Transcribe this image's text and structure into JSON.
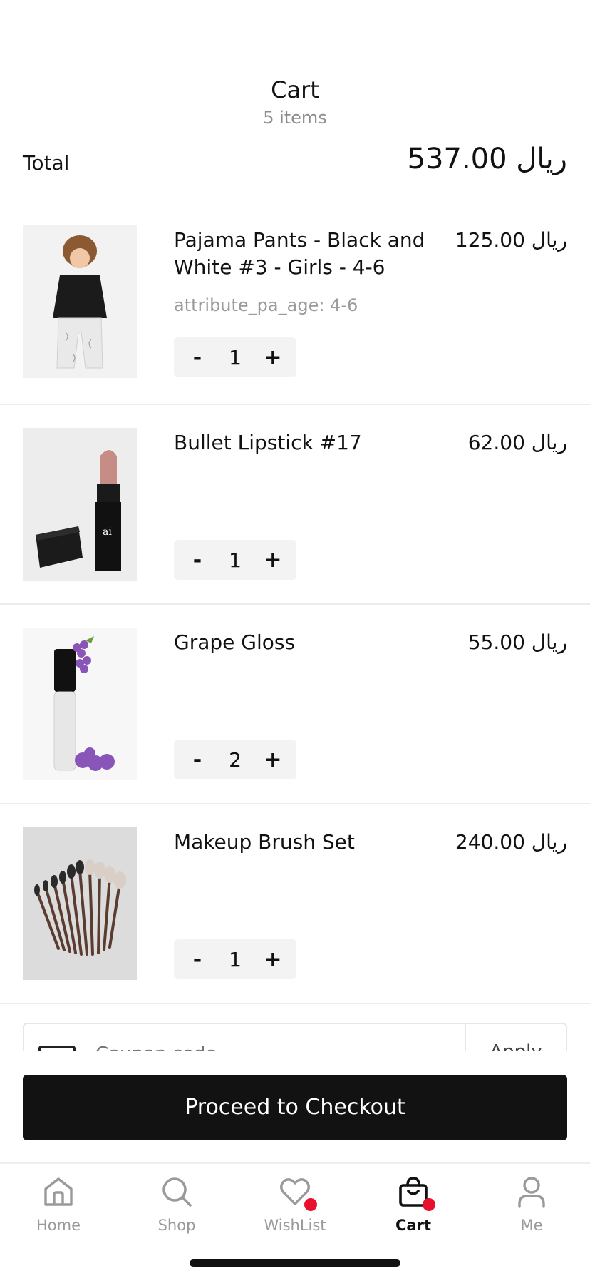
{
  "header": {
    "title": "Cart",
    "subtitle": "5 items"
  },
  "summary": {
    "total_label": "Total",
    "total_amount": "537.00",
    "currency": "ريال"
  },
  "items": [
    {
      "name": "Pajama Pants - Black and White #3 - Girls - 4-6",
      "price": "125.00",
      "currency": "ريال",
      "attribute": "attribute_pa_age: 4-6",
      "quantity": "1",
      "minus": "-",
      "plus": "+"
    },
    {
      "name": "Bullet Lipstick #17",
      "price": "62.00",
      "currency": "ريال",
      "quantity": "1",
      "minus": "-",
      "plus": "+"
    },
    {
      "name": "Grape Gloss",
      "price": "55.00",
      "currency": "ريال",
      "quantity": "2",
      "minus": "-",
      "plus": "+"
    },
    {
      "name": "Makeup Brush Set",
      "price": "240.00",
      "currency": "ريال",
      "quantity": "1",
      "minus": "-",
      "plus": "+"
    }
  ],
  "coupon": {
    "placeholder": "Coupon code",
    "apply_label": "Apply"
  },
  "checkout": {
    "label": "Proceed to Checkout"
  },
  "tabbar": {
    "items": [
      {
        "label": "Home",
        "icon": "home-icon"
      },
      {
        "label": "Shop",
        "icon": "search-icon"
      },
      {
        "label": "WishList",
        "icon": "heart-icon"
      },
      {
        "label": "Cart",
        "icon": "shopping-bag-icon"
      },
      {
        "label": "Me",
        "icon": "user-icon"
      }
    ],
    "active": "Cart",
    "badge_color": "#e8102d"
  }
}
